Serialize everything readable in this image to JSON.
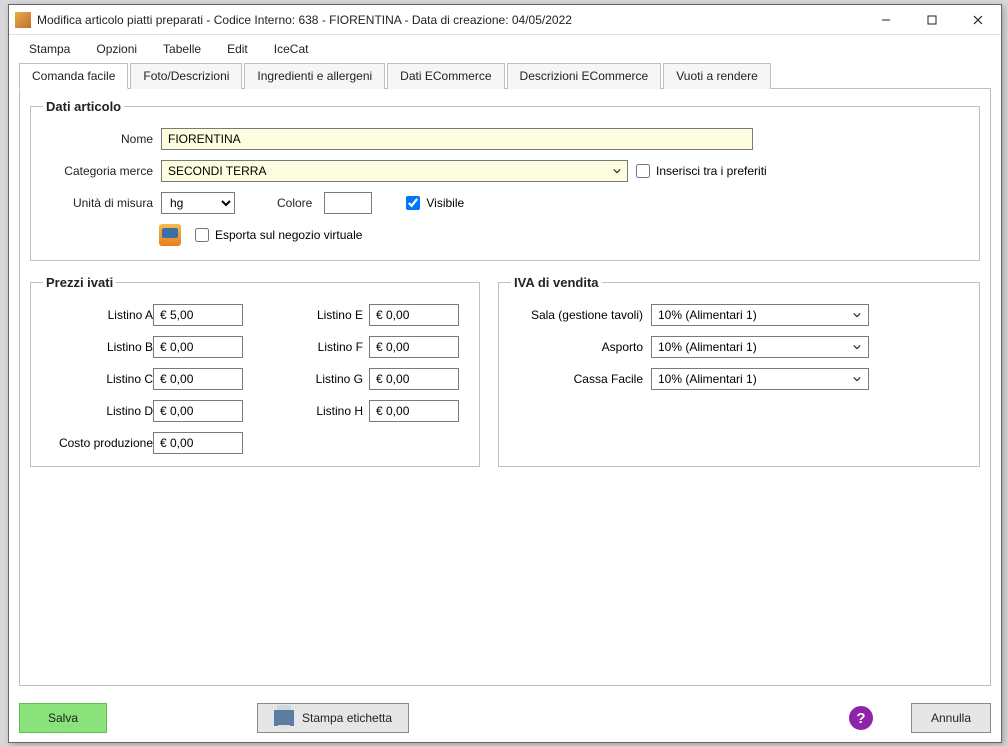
{
  "window": {
    "title": "Modifica articolo piatti preparati - Codice Interno: 638 - FIORENTINA - Data di creazione: 04/05/2022"
  },
  "menu": {
    "items": [
      "Stampa",
      "Opzioni",
      "Tabelle",
      "Edit",
      "IceCat"
    ]
  },
  "tabs": {
    "items": [
      "Comanda facile",
      "Foto/Descrizioni",
      "Ingredienti e allergeni",
      "Dati ECommerce",
      "Descrizioni ECommerce",
      "Vuoti a rendere"
    ],
    "active": 0
  },
  "sections": {
    "dati_articolo": {
      "legend": "Dati articolo",
      "labels": {
        "nome": "Nome",
        "categoria_merce": "Categoria merce",
        "unita_di_misura": "Unità di misura",
        "colore": "Colore",
        "visibile": "Visibile",
        "inserisci_preferiti": "Inserisci tra i preferiti",
        "esporta_negozio": "Esporta sul negozio virtuale"
      },
      "values": {
        "nome": "FIORENTINA",
        "categoria_merce": "SECONDI TERRA",
        "unita_di_misura": "hg",
        "colore": "",
        "visibile_checked": true,
        "preferiti_checked": false,
        "esporta_checked": false
      }
    },
    "prezzi_ivati": {
      "legend": "Prezzi ivati",
      "labels": {
        "listino_a": "Listino A",
        "listino_b": "Listino B",
        "listino_c": "Listino C",
        "listino_d": "Listino D",
        "listino_e": "Listino E",
        "listino_f": "Listino F",
        "listino_g": "Listino G",
        "listino_h": "Listino H",
        "costo_produzione": "Costo produzione"
      },
      "values": {
        "listino_a": "€ 5,00",
        "listino_b": "€ 0,00",
        "listino_c": "€ 0,00",
        "listino_d": "€ 0,00",
        "listino_e": "€ 0,00",
        "listino_f": "€ 0,00",
        "listino_g": "€ 0,00",
        "listino_h": "€ 0,00",
        "costo_produzione": "€ 0,00"
      }
    },
    "iva_vendita": {
      "legend": "IVA di vendita",
      "labels": {
        "sala": "Sala (gestione tavoli)",
        "asporto": "Asporto",
        "cassa_facile": "Cassa Facile"
      },
      "values": {
        "sala": "10% (Alimentari 1)",
        "asporto": "10% (Alimentari 1)",
        "cassa_facile": "10% (Alimentari 1)"
      }
    }
  },
  "footer": {
    "salva": "Salva",
    "stampa_etichetta": "Stampa etichetta",
    "annulla": "Annulla"
  }
}
